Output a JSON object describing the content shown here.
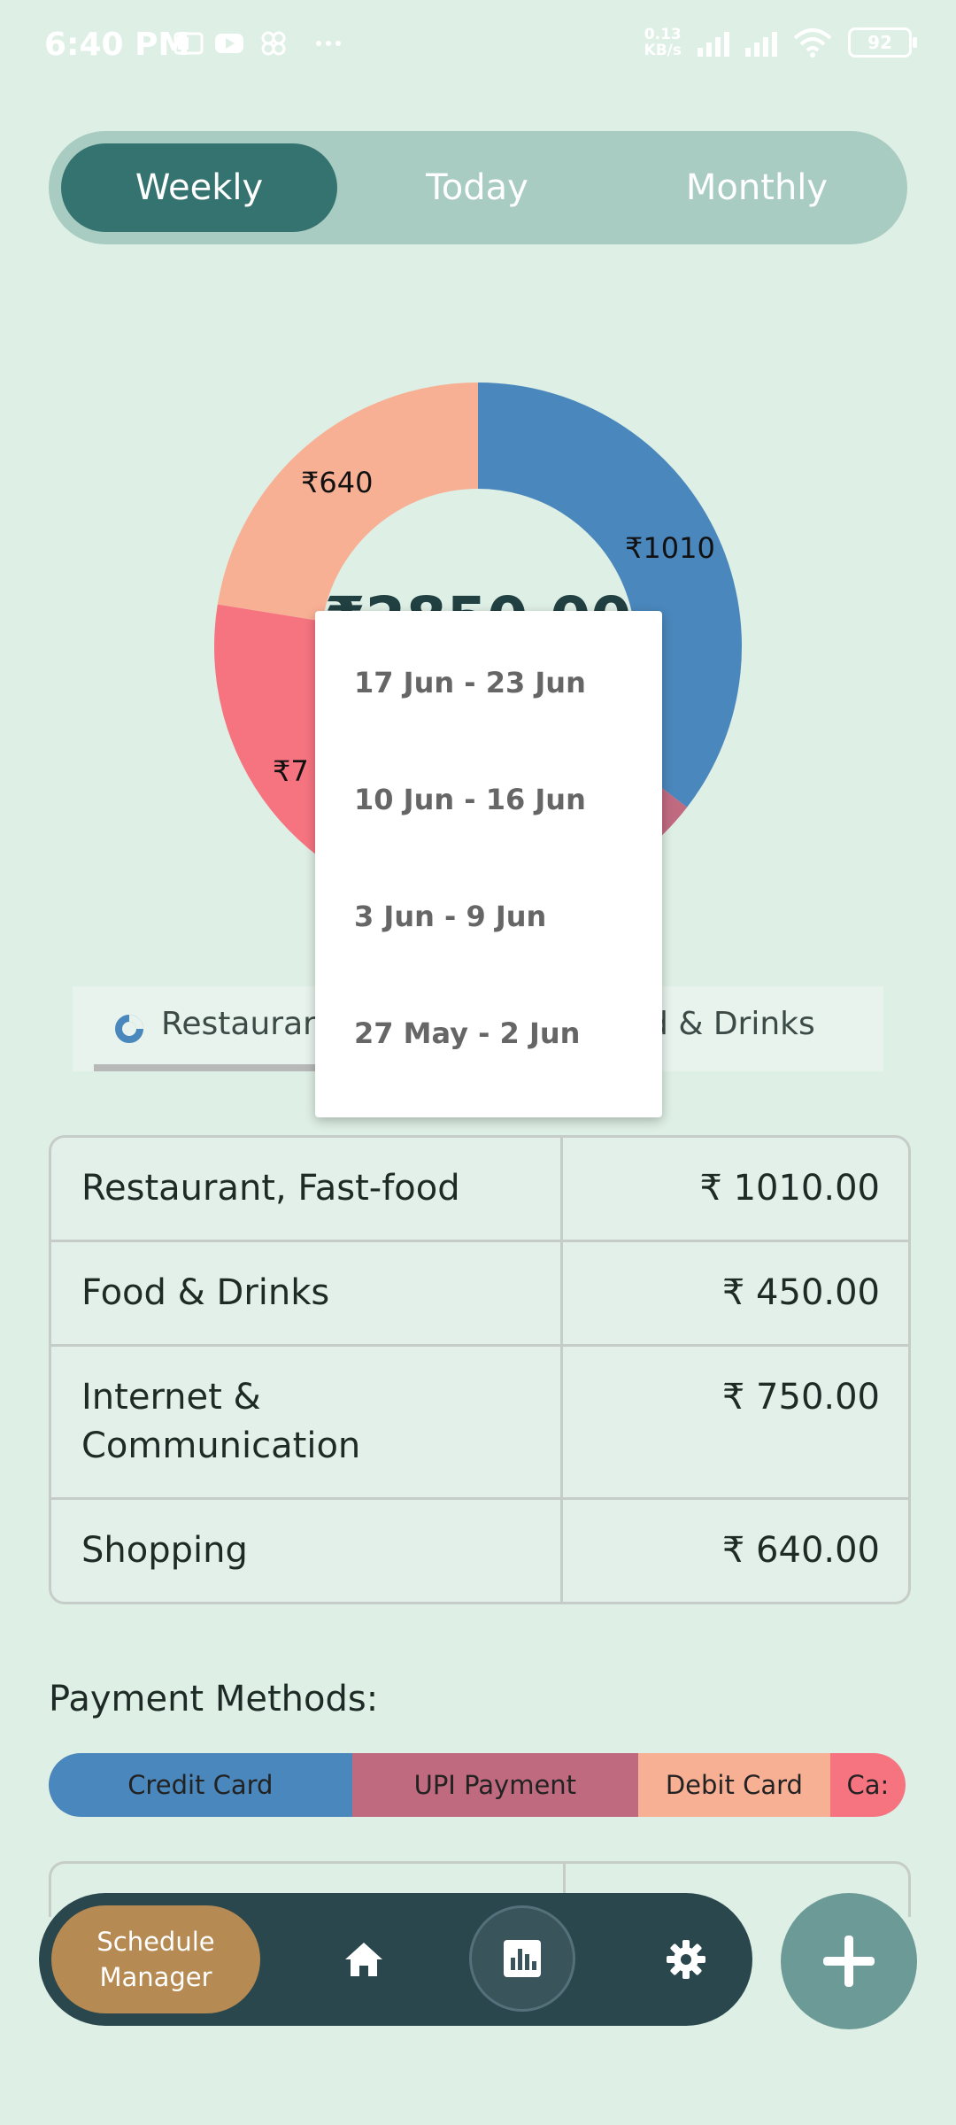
{
  "status_bar": {
    "time": "6:40 PM",
    "net_speed_value": "0.13",
    "net_speed_unit": "KB/s",
    "battery": "92"
  },
  "period_tabs": [
    {
      "label": "Weekly",
      "active": true
    },
    {
      "label": "Today",
      "active": false
    },
    {
      "label": "Monthly",
      "active": false
    }
  ],
  "chart_data": {
    "type": "pie",
    "center_total": "₹2850.00",
    "slices": [
      {
        "label": "₹1010",
        "value": 1010,
        "color": "#4a87bc"
      },
      {
        "label": "₹450",
        "value": 450,
        "color": "#c06a80"
      },
      {
        "label": "₹750",
        "value": 750,
        "color": "#f57480"
      },
      {
        "label": "₹640",
        "value": 640,
        "color": "#f8b095"
      }
    ],
    "visible_labels": {
      "restaurant": "₹1010",
      "shopping": "₹640",
      "internet": "₹7"
    }
  },
  "category_tabs": {
    "first": "Restaurant, Fast-food",
    "first_visible": "Restaurar",
    "second_visible": "od & Drinks"
  },
  "dropdown": {
    "items": [
      "17 Jun - 23 Jun",
      "10 Jun - 16 Jun",
      "3 Jun - 9 Jun",
      "27 May - 2 Jun"
    ]
  },
  "expense_table": [
    {
      "name": "Restaurant, Fast-food",
      "amount": "₹ 1010.00"
    },
    {
      "name": "Food & Drinks",
      "amount": "₹ 450.00"
    },
    {
      "name": "Internet & Communication",
      "amount": "₹ 750.00"
    },
    {
      "name": "Shopping",
      "amount": "₹ 640.00"
    }
  ],
  "payment_methods": {
    "title": "Payment Methods:",
    "items": [
      {
        "label": "Credit Card",
        "color": "#4a87bc",
        "share": 0.354
      },
      {
        "label": "UPI Payment",
        "color": "#c06a80",
        "share": 0.334
      },
      {
        "label": "Debit Card",
        "color": "#f8b095",
        "share": 0.224
      },
      {
        "label": "Ca:",
        "color": "#f57480",
        "share": 0.088
      }
    ]
  },
  "bottom_nav": {
    "schedule_line1": "Schedule",
    "schedule_line2": "Manager"
  },
  "colors": {
    "background": "#deefe5",
    "accent": "#357370",
    "nav": "#2a474d",
    "schedule": "#b68a53",
    "fab": "#6c9a97"
  }
}
